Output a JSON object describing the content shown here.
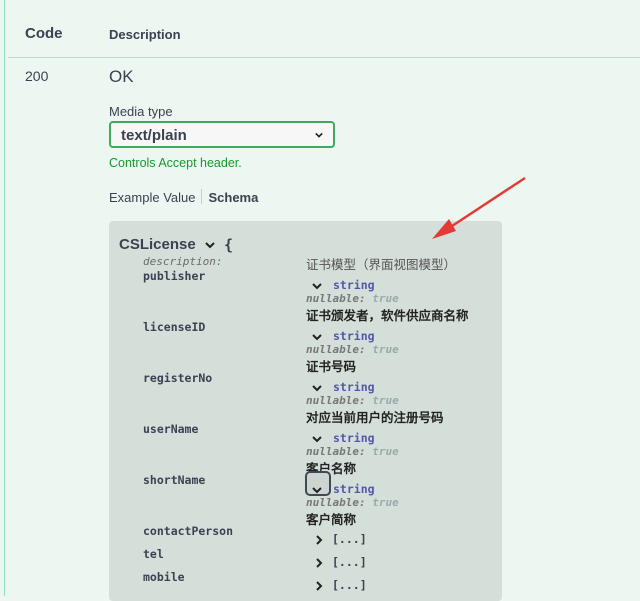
{
  "table": {
    "code_header": "Code",
    "description_header": "Description"
  },
  "response": {
    "code": "200",
    "description": "OK",
    "media_type_label": "Media type",
    "media_type_value": "text/plain",
    "controls_text": "Controls Accept header.",
    "tabs": {
      "example": "Example Value",
      "schema": "Schema"
    }
  },
  "model": {
    "name": "CSLicense",
    "open_brace": "{",
    "description_key": "description:",
    "description_value": "证书模型（界面视图模型）",
    "properties": [
      {
        "name": "publisher",
        "type": "string",
        "nullable_key": "nullable:",
        "nullable_value": "true",
        "desc": "证书颁发者，软件供应商名称"
      },
      {
        "name": "licenseID",
        "type": "string",
        "nullable_key": "nullable:",
        "nullable_value": "true",
        "desc": "证书号码"
      },
      {
        "name": "registerNo",
        "type": "string",
        "nullable_key": "nullable:",
        "nullable_value": "true",
        "desc": "对应当前用户的注册号码"
      },
      {
        "name": "userName",
        "type": "string",
        "nullable_key": "nullable:",
        "nullable_value": "true",
        "desc": "客户名称"
      },
      {
        "name": "shortName",
        "type": "string",
        "nullable_key": "nullable:",
        "nullable_value": "true",
        "desc": "客户简称"
      }
    ],
    "collapsed_properties": [
      {
        "name": "contactPerson",
        "value": "[...]"
      },
      {
        "name": "tel",
        "value": "[...]"
      },
      {
        "name": "mobile",
        "value": "[...]"
      }
    ]
  },
  "colors": {
    "accent_green": "#49cc90",
    "select_border": "#41a95f",
    "annotation_arrow": "#e53935"
  }
}
